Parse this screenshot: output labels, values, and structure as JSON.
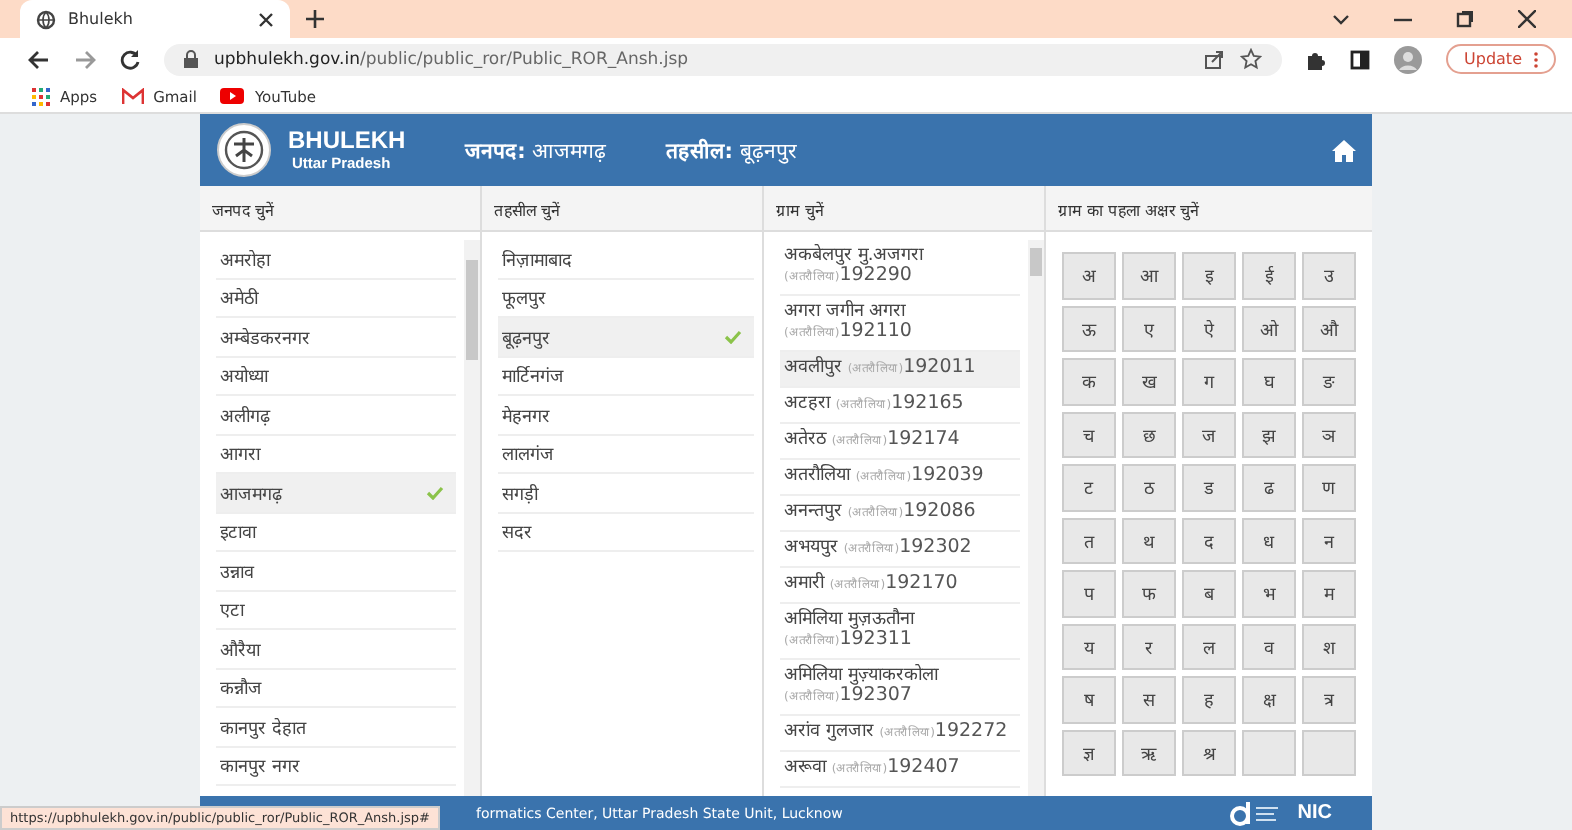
{
  "browser": {
    "tab_title": "Bhulekh",
    "url_host": "upbhulekh.gov.in",
    "url_path": "/public/public_ror/Public_ROR_Ansh.jsp",
    "update_label": "Update",
    "bookmarks": [
      {
        "kind": "apps",
        "label": "Apps"
      },
      {
        "kind": "gmail",
        "label": "Gmail"
      },
      {
        "kind": "youtube",
        "label": "YouTube"
      }
    ]
  },
  "header": {
    "brand": "BHULEKH",
    "subtitle": "Uttar Pradesh",
    "district_label": "जनपद:",
    "district_value": "आजमगढ़",
    "tehsil_label": "तहसील:",
    "tehsil_value": "बूढ़नपुर"
  },
  "columns": [
    {
      "title": "जनपद चुनें"
    },
    {
      "title": "तहसील चुनें"
    },
    {
      "title": "ग्राम चुनें"
    },
    {
      "title": "ग्राम का पहला अक्षर चुनें"
    }
  ],
  "districts": [
    {
      "name": "अमरोहा",
      "selected": false
    },
    {
      "name": "अमेठी",
      "selected": false
    },
    {
      "name": "अम्बेडकरनगर",
      "selected": false
    },
    {
      "name": "अयोध्या",
      "selected": false
    },
    {
      "name": "अलीगढ़",
      "selected": false
    },
    {
      "name": "आगरा",
      "selected": false
    },
    {
      "name": "आजमगढ़",
      "selected": true
    },
    {
      "name": "इटावा",
      "selected": false
    },
    {
      "name": "उन्नाव",
      "selected": false
    },
    {
      "name": "एटा",
      "selected": false
    },
    {
      "name": "औरैया",
      "selected": false
    },
    {
      "name": "कन्नौज",
      "selected": false
    },
    {
      "name": "कानपुर देहात",
      "selected": false
    },
    {
      "name": "कानपुर नगर",
      "selected": false
    }
  ],
  "tehsils": [
    {
      "name": "निज़ामाबाद",
      "selected": false
    },
    {
      "name": "फूलपुर",
      "selected": false
    },
    {
      "name": "बूढ़नपुर",
      "selected": true
    },
    {
      "name": "मार्टिनगंज",
      "selected": false
    },
    {
      "name": "मेहनगर",
      "selected": false
    },
    {
      "name": "लालगंज",
      "selected": false
    },
    {
      "name": "सगड़ी",
      "selected": false
    },
    {
      "name": "सदर",
      "selected": false
    }
  ],
  "villages": [
    {
      "name": "अकबेलपुर मु.अजगरा",
      "pargana": "(अतरौलिया)",
      "code": "192290",
      "selected": false
    },
    {
      "name": "अगरा जगीन अगरा",
      "pargana": "(अतरौलिया)",
      "code": "192110",
      "selected": false
    },
    {
      "name": "अवलीपुर",
      "pargana": "(अतरौलिया)",
      "code": "192011",
      "selected": true
    },
    {
      "name": "अटहरा",
      "pargana": "(अतरौलिया)",
      "code": "192165",
      "selected": false
    },
    {
      "name": "अतेरठ",
      "pargana": "(अतरौलिया)",
      "code": "192174",
      "selected": false
    },
    {
      "name": "अतरौलिया",
      "pargana": "(अतरौलिया)",
      "code": "192039",
      "selected": false
    },
    {
      "name": "अनन्तपुर",
      "pargana": "(अतरौलिया)",
      "code": "192086",
      "selected": false
    },
    {
      "name": "अभयपुर",
      "pargana": "(अतरौलिया)",
      "code": "192302",
      "selected": false
    },
    {
      "name": "अमारी",
      "pargana": "(अतरौलिया)",
      "code": "192170",
      "selected": false
    },
    {
      "name": "अमिलिया मुज़ऊतौना",
      "pargana": "(अतरौलिया)",
      "code": "192311",
      "selected": false
    },
    {
      "name": "अमिलिया मुज़्याकरकोला",
      "pargana": "(अतरौलिया)",
      "code": "192307",
      "selected": false
    },
    {
      "name": "अरांव गुलजार",
      "pargana": "(अतरौलिया)",
      "code": "192272",
      "selected": false
    },
    {
      "name": "अरूवा",
      "pargana": "(अतरौलिया)",
      "code": "192407",
      "selected": false
    }
  ],
  "letters": [
    "अ",
    "आ",
    "इ",
    "ई",
    "उ",
    "ऊ",
    "ए",
    "ऐ",
    "ओ",
    "औ",
    "क",
    "ख",
    "ग",
    "घ",
    "ङ",
    "च",
    "छ",
    "ज",
    "झ",
    "ञ",
    "ट",
    "ठ",
    "ड",
    "ढ",
    "ण",
    "त",
    "थ",
    "द",
    "ध",
    "न",
    "प",
    "फ",
    "ब",
    "भ",
    "म",
    "य",
    "र",
    "ल",
    "व",
    "श",
    "ष",
    "स",
    "ह",
    "क्ष",
    "त्र",
    "ज्ञ",
    "ऋ",
    "श्र"
  ],
  "footer": {
    "text": "formatics Center, Uttar Pradesh State Unit, Lucknow",
    "nic": "NIC"
  },
  "status_url": "https://upbhulekh.gov.in/public/public_ror/Public_ROR_Ansh.jsp#"
}
